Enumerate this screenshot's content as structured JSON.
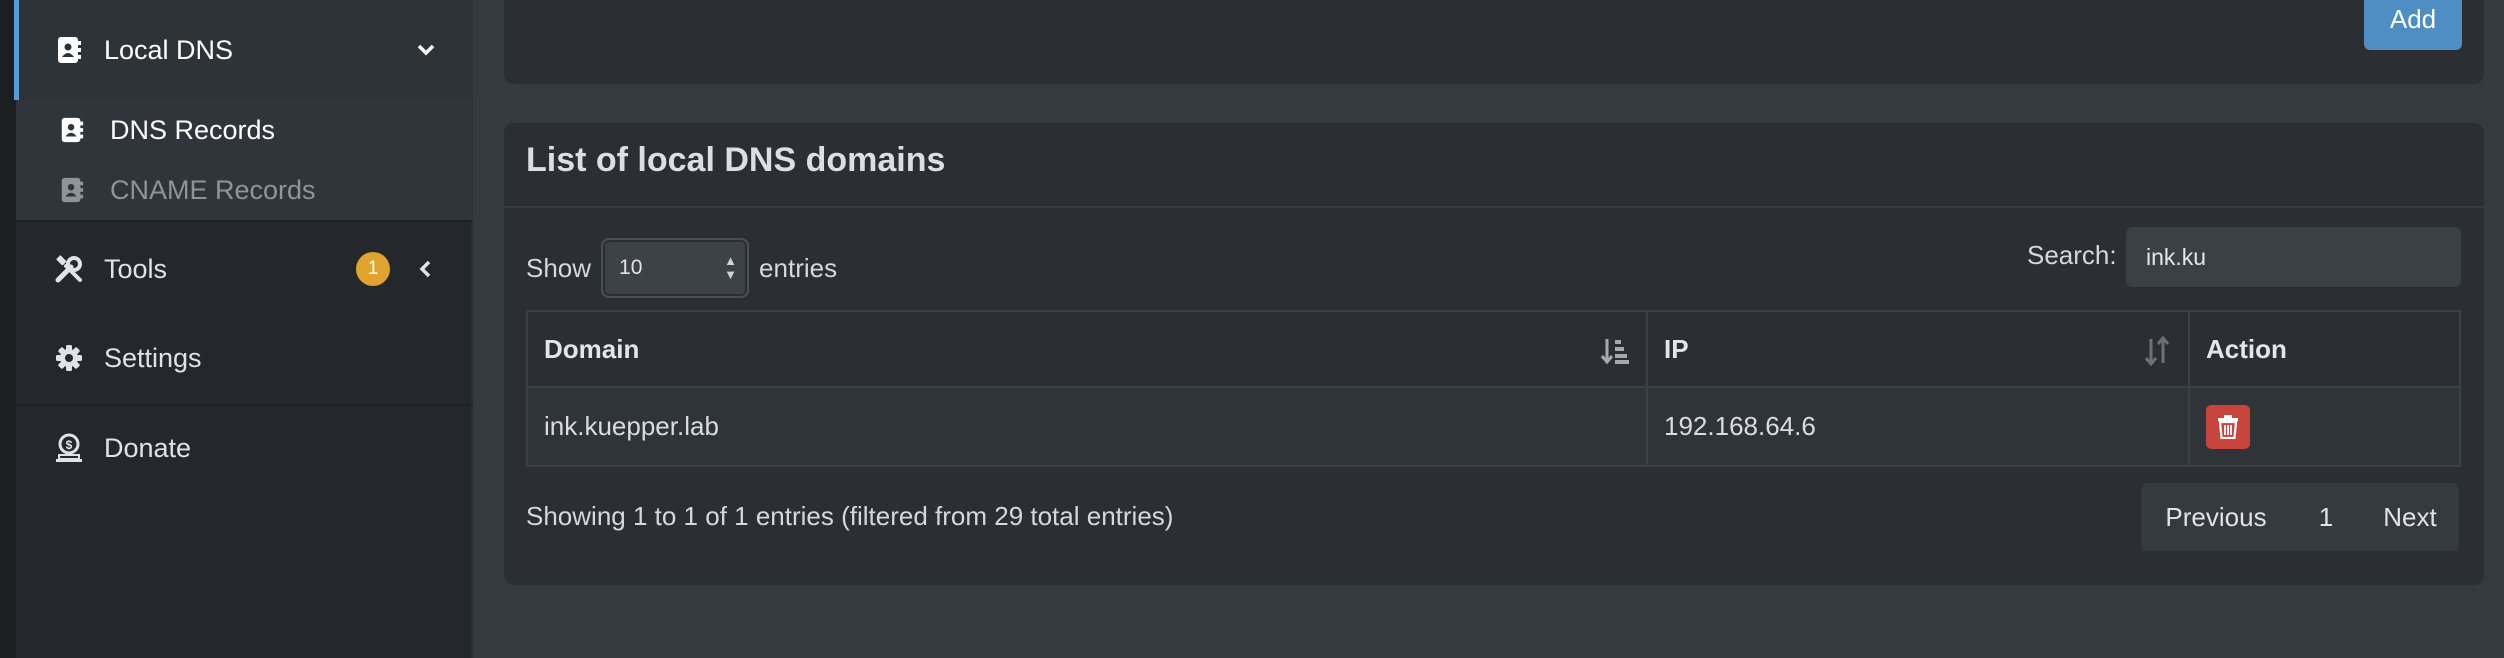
{
  "sidebar": {
    "local_dns": {
      "label": "Local DNS",
      "icon": "contact-book-icon"
    },
    "sub_items": [
      {
        "label": "DNS Records",
        "icon": "contact-book-icon",
        "color": "#ffffff"
      },
      {
        "label": "CNAME Records",
        "icon": "contact-book-icon",
        "color": "#8e949a"
      }
    ],
    "tools": {
      "label": "Tools",
      "badge": "1",
      "icon": "tools-icon"
    },
    "settings": {
      "label": "Settings",
      "icon": "gear-icon"
    },
    "donate": {
      "label": "Donate",
      "icon": "donate-icon"
    }
  },
  "top_card": {
    "add_label": "Add"
  },
  "list": {
    "title": "List of local DNS domains",
    "show_label": "Show",
    "entries_value": "10",
    "entries_label": "entries",
    "search_label": "Search:",
    "search_value": "ink.ku",
    "columns": [
      "Domain",
      "IP",
      "Action"
    ],
    "rows": [
      {
        "domain": "ink.kuepper.lab",
        "ip": "192.168.64.6"
      }
    ],
    "info": "Showing 1 to 1 of 1 entries (filtered from 29 total entries)",
    "pagination": {
      "previous": "Previous",
      "page": "1",
      "next": "Next"
    }
  },
  "colors": {
    "accent": "#5b9bd5",
    "add_button": "#4f8ec5",
    "badge": "#e0a32e",
    "delete": "#c7453c",
    "background": "#353a3f",
    "sidebar": "#24282c",
    "card": "#2b2f33"
  }
}
